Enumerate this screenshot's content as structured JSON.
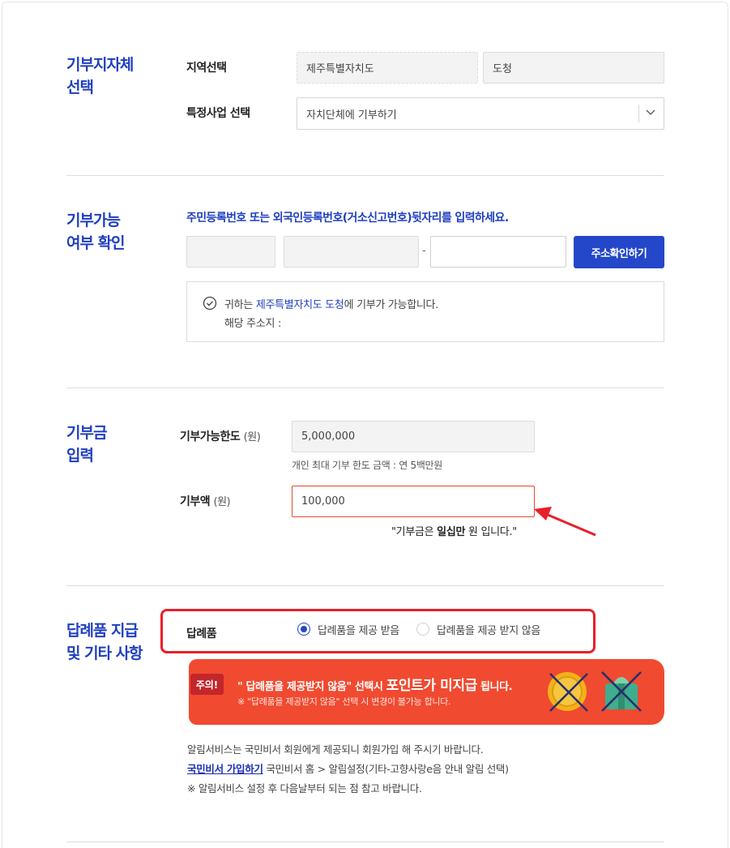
{
  "region_section": {
    "title_line1": "기부지자체",
    "title_line2": "선택",
    "region_label": "지역선택",
    "province_value": "제주특별자치도",
    "district_value": "도청",
    "project_label": "특정사업 선택",
    "project_value": "자치단체에 기부하기"
  },
  "eligibility_section": {
    "title_line1": "기부가능",
    "title_line2": "여부 확인",
    "instruction": "주민등록번호 또는 외국인등록번호(거소신고번호)뒷자리를 입력하세요.",
    "id_separator": "-",
    "check_button": "주소확인하기",
    "notice_prefix": "귀하는 ",
    "notice_region": "제주특별자치도 도청",
    "notice_suffix": "에 기부가 가능합니다.",
    "address_label": "해당 주소지 :"
  },
  "amount_section": {
    "title_line1": "기부금",
    "title_line2": "입력",
    "limit_label": "기부가능한도",
    "limit_unit": "(원)",
    "limit_value": "5,000,000",
    "limit_help": "개인 최대 기부 한도 금액 : 연 5백만원",
    "amount_label": "기부액",
    "amount_unit": "(원)",
    "amount_value": "100,000",
    "quote_prefix": "\"기부금은 ",
    "quote_bold": "일십만",
    "quote_suffix": " 원 입니다.\""
  },
  "gift_section": {
    "title_line1": "답례품 지급",
    "title_line2": "및 기타 사항",
    "gift_label": "답례품",
    "option_receive": "답례품을 제공 받음",
    "option_decline": "답례품을 제공 받지 않음",
    "selected_option": "답례품을 제공 받음",
    "caution_badge": "주의!",
    "banner_text_pre": "\" 답례품을 제공받지 않음\" 선택시 ",
    "banner_text_big": "포인트가 미지급",
    "banner_text_post": " 됩니다.",
    "banner_sub": "※ \"답례품을 제공받지 않음\" 선택 시 변경이 불가능 합니다.",
    "info_line1": "알림서비스는 국민비서 회원에게 제공되니 회원가입 해 주시기 바랍니다.",
    "join_link": "국민비서 가입하기",
    "info_line2_rest": " 국민비서 홈 > 알림설정(기타-고향사랑e음 안내 알림 선택)",
    "info_line3": "※ 알림서비스 설정 후 다음날부터 되는 점 참고 바랍니다."
  },
  "colors": {
    "brand_blue": "#1f3fbf",
    "button_blue": "#2447c9",
    "alert_red": "#e8202a",
    "banner_orange": "#f04a30"
  }
}
